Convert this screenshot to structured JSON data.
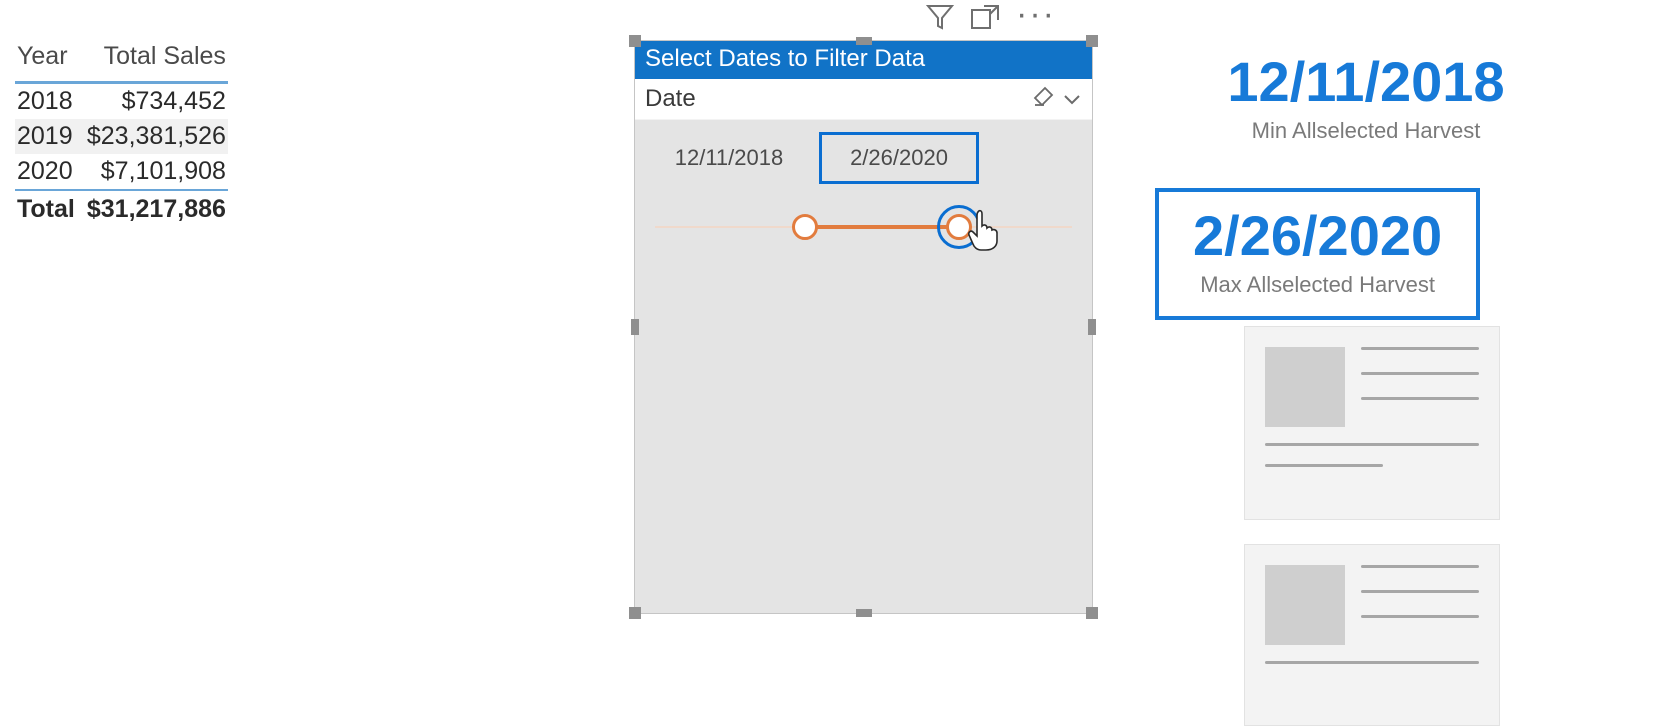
{
  "table": {
    "headers": [
      "Year",
      "Total Sales"
    ],
    "rows": [
      {
        "year": "2018",
        "sales": "$734,452"
      },
      {
        "year": "2019",
        "sales": "$23,381,526"
      },
      {
        "year": "2020",
        "sales": "$7,101,908"
      }
    ],
    "total_label": "Total",
    "total_value": "$31,217,886"
  },
  "slicer": {
    "title": "Select Dates to Filter Data",
    "field": "Date",
    "from": "12/11/2018",
    "to": "2/26/2020",
    "slider_left_pct": 36,
    "slider_right_pct": 73
  },
  "card_min": {
    "value": "12/11/2018",
    "label": "Min Allselected Harvest"
  },
  "card_max": {
    "value": "2/26/2020",
    "label": "Max Allselected Harvest"
  }
}
